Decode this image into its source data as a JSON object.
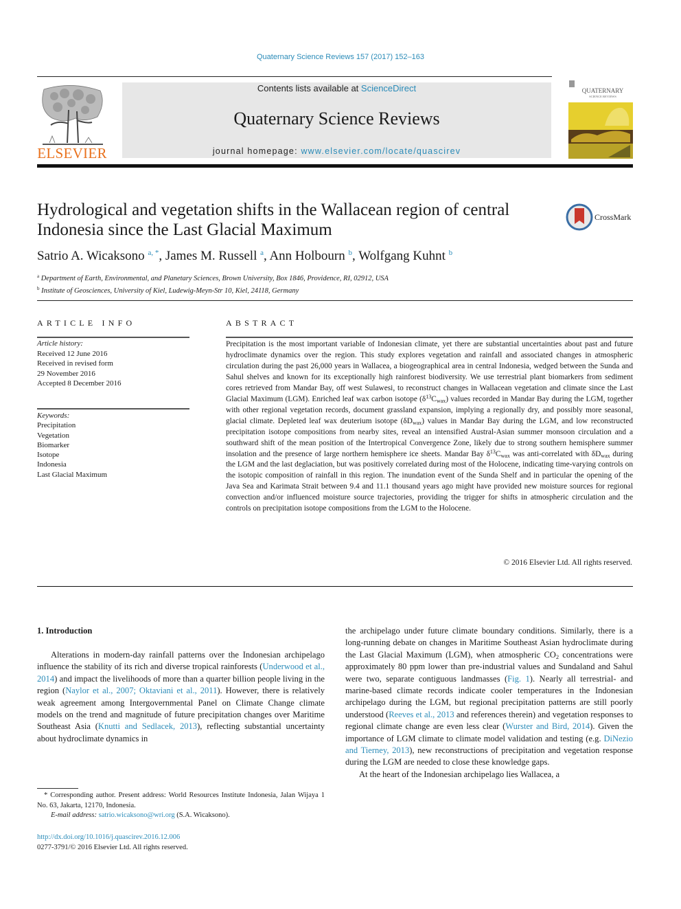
{
  "header": {
    "journal_citation": "Quaternary Science Reviews 157 (2017) 152–163",
    "publisher_logo_text": "ELSEVIER",
    "contents_prefix": "Contents lists available at ",
    "contents_link": "ScienceDirect",
    "journal_name": "Quaternary Science Reviews",
    "homepage_prefix": "journal homepage: ",
    "homepage_link": "www.elsevier.com/locate/quascirev",
    "cover_title": "QUATERNARY",
    "cover_subtitle": "SCIENCE REVIEWS",
    "crossmark_label": "CrossMark"
  },
  "article": {
    "title": "Hydrological and vegetation shifts in the Wallacean region of central Indonesia since the Last Glacial Maximum",
    "authors": [
      {
        "name": "Satrio A. Wicaksono",
        "marks": "a, *"
      },
      {
        "name": "James M. Russell",
        "marks": "a"
      },
      {
        "name": "Ann Holbourn",
        "marks": "b"
      },
      {
        "name": "Wolfgang Kuhnt",
        "marks": "b"
      }
    ],
    "affiliations": [
      {
        "mark": "a",
        "text": "Department of Earth, Environmental, and Planetary Sciences, Brown University, Box 1846, Providence, RI, 02912, USA"
      },
      {
        "mark": "b",
        "text": "Institute of Geosciences, University of Kiel, Ludewig-Meyn-Str 10, Kiel, 24118, Germany"
      }
    ]
  },
  "article_info": {
    "heading": "ARTICLE INFO",
    "history_label": "Article history:",
    "history": [
      "Received 12 June 2016",
      "Received in revised form",
      "29 November 2016",
      "Accepted 8 December 2016"
    ],
    "keywords_label": "Keywords:",
    "keywords": [
      "Precipitation",
      "Vegetation",
      "Biomarker",
      "Isotope",
      "Indonesia",
      "Last Glacial Maximum"
    ]
  },
  "abstract": {
    "heading": "ABSTRACT",
    "p1": "Precipitation is the most important variable of Indonesian climate, yet there are substantial uncertainties about past and future hydroclimate dynamics over the region. This study explores vegetation and rainfall and associated changes in atmospheric circulation during the past 26,000 years in Wallacea, a biogeo­graphical area in central Indonesia, wedged between the Sunda and Sahul shelves and known for its exceptionally high rainforest biodiversity. We use terrestrial plant biomarkers from sediment cores retrieved from Mandar Bay, off west Sulawesi, to reconstruct changes in Wallacean vegetation and climate since the Last Glacial Maximum (LGM). Enriched leaf wax carbon isotope (",
    "d13c_delta": "δ",
    "d13c_sup": "13",
    "d13c_c": "C",
    "wax_sub": "wax",
    "p2": ") values recorded in Mandar Bay during the LGM, together with other regional vegetation records, document grassland expansion, implying a regionally dry, and possibly more seasonal, glacial climate. Depleted leaf wax deuterium isotope (",
    "dD": "δD",
    "p3": ") values in Mandar Bay during the LGM, and low reconstructed precipi­tation isotope compositions from nearby sites, reveal an intensified Austral-Asian summer monsoon circulation and a southward shift of the mean position of the Intertropical Convergence Zone, likely due to strong southern hemisphere summer insolation and the presence of large northern hemisphere ice sheets. Mandar Bay ",
    "p4": " was anti-correlated with ",
    "p5": " during the LGM and the last deglaciation, but was positively correlated during most of the Holocene, indicating time-varying controls on the isotopic composition of rainfall in this region. The inundation event of the Sunda Shelf and in particular the opening of the Java Sea and Karimata Strait between 9.4 and 11.1 thousand years ago might have pro­vided new moisture sources for regional convection and/or influenced moisture source trajectories, providing the trigger for shifts in atmospheric circulation and the controls on precipitation isotope compositions from the LGM to the Holocene.",
    "copyright": "© 2016 Elsevier Ltd. All rights reserved."
  },
  "body": {
    "section_heading": "1.  Introduction",
    "left": {
      "t1": "Alterations in modern-day rainfall patterns over the Indonesian archipelago influence the stability of its rich and diverse tropical rainforests (",
      "c1": "Underwood et al., 2014",
      "t2": ") and impact the livelihoods of more than a quarter billion people living in the region (",
      "c2": "Naylor et al., 2007; Oktaviani et al., 2011",
      "t3": "). However, there is relatively weak agreement among Intergovernmental Panel on Climate Change climate models on the trend and magnitude of future precipitation changes over Maritime Southeast Asia (",
      "c3": "Knutti and Sedlacek, 2013",
      "t4": "), reflecting substantial uncertainty about hydroclimate dynamics in"
    },
    "right": {
      "t1": "the archipelago under future climate boundary conditions. Simi­larly, there is a long-running debate on changes in Maritime Southeast Asian hydroclimate during the Last Glacial Maximum (LGM), when atmospheric CO",
      "co2_sub": "2",
      "t2": " concentrations were approximately 80 ppm lower than pre-industrial values and Sundaland and Sahul were two, separate contiguous landmasses (",
      "c1": "Fig. 1",
      "t3": "). Nearly all terrestrial- and marine-based climate records indicate cooler temperatures in the Indonesian archipelago during the LGM, but regional precipitation patterns are still poorly understood (",
      "c2": "Reeves et al., 2013",
      "t4": " and references therein) and vegetation responses to regional climate change are even less clear (",
      "c3": "Wurster and Bird, 2014",
      "t5": "). Given the importance of LGM climate to climate model validation and testing (e.g. ",
      "c4": "DiNezio and Tierney, 2013",
      "t6": "), new re­constructions of precipitation and vegetation response during the LGM are needed to close these knowledge gaps.",
      "p2": "At the heart of the Indonesian archipelago lies Wallacea, a"
    }
  },
  "footnote": {
    "corresponding": "* Corresponding author. Present address: World Resources Institute Indonesia, Jalan Wijaya 1 No. 63, Jakarta, 12170, Indonesia.",
    "email_label": "E-mail address: ",
    "email": "satrio.wicaksono@wri.org",
    "email_suffix": " (S.A. Wicaksono).",
    "doi": "http://dx.doi.org/10.1016/j.quascirev.2016.12.006",
    "issn": "0277-3791/© 2016 Elsevier Ltd. All rights reserved."
  },
  "colors": {
    "link": "#2a8bb8",
    "elsevier_orange": "#e9711c",
    "header_box": "#e7e7e7"
  }
}
